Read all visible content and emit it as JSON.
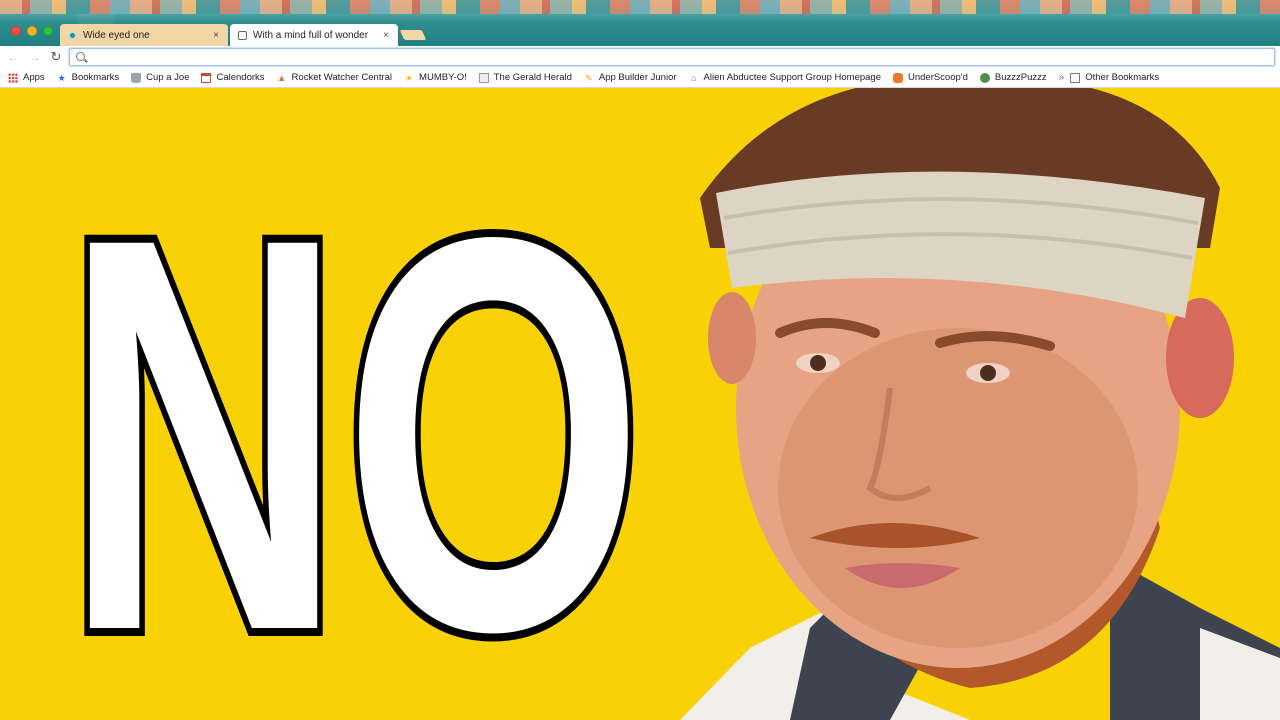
{
  "window": {
    "traffic_lights": [
      "close",
      "minimize",
      "zoom"
    ]
  },
  "tabs": [
    {
      "title": "Wide eyed one",
      "close": "×",
      "active": false
    },
    {
      "title": "With a mind full of wonder",
      "close": "×",
      "active": true
    }
  ],
  "toolbar": {
    "back": "←",
    "forward": "→",
    "reload": "↻",
    "omnibox": {
      "value": "",
      "placeholder": ""
    }
  },
  "bookmarks": [
    {
      "label": "Apps",
      "icon": "apps-grid-icon"
    },
    {
      "label": "Bookmarks",
      "icon": "star-icon"
    },
    {
      "label": "Cup a Joe",
      "icon": "cup-icon"
    },
    {
      "label": "Calendorks",
      "icon": "calendar-icon"
    },
    {
      "label": "Rocket Watcher Central",
      "icon": "rocket-icon"
    },
    {
      "label": "MUMBY-O!",
      "icon": "star-yellow-icon"
    },
    {
      "label": "The Gerald Herald",
      "icon": "newspaper-icon"
    },
    {
      "label": "App Builder Junior",
      "icon": "pencil-icon"
    },
    {
      "label": "Alien Abductee Support Group Homepage",
      "icon": "ufo-icon"
    },
    {
      "label": "UnderScoop'd",
      "icon": "fox-icon"
    },
    {
      "label": "BuzzzPuzzz",
      "icon": "bee-icon"
    }
  ],
  "bookmarks_overflow": "»",
  "other_bookmarks": "Other Bookmarks",
  "page": {
    "headline": "NO",
    "background_color": "#f9d107",
    "photo_subject": "man-with-headband"
  }
}
